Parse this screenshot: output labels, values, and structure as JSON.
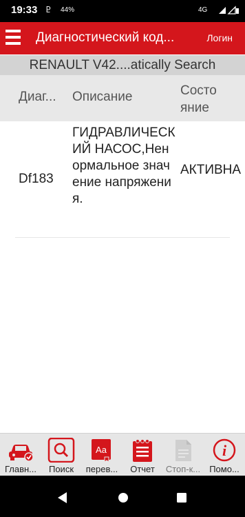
{
  "status": {
    "time": "19:33",
    "usb_glyph": "Ⴒ",
    "battery": "44%",
    "network": "4G"
  },
  "header": {
    "title": "Диагностический код...",
    "login": "Логин"
  },
  "vehicle_bar": "RENAULT V42....atically Search",
  "table": {
    "columns": [
      "Диаг...",
      "Описание",
      "Состо",
      "яние"
    ],
    "rows": [
      {
        "code": "Df183",
        "description": "ГИДРАВЛИЧЕСКИЙ НАСОС,Ненормальное значение напряжения.",
        "state": "АКТИВНА"
      }
    ]
  },
  "toolbar": {
    "items": [
      {
        "label": "Главн...",
        "icon": "car-check-icon"
      },
      {
        "label": "Поиск",
        "icon": "search-icon"
      },
      {
        "label": "перев...",
        "icon": "translate-icon"
      },
      {
        "label": "Отчет",
        "icon": "report-icon"
      },
      {
        "label": "Стоп-к...",
        "icon": "freeze-frame-icon"
      },
      {
        "label": "Помо...",
        "icon": "help-icon"
      }
    ]
  },
  "colors": {
    "accent": "#d4161c",
    "vehicle_bar_bg": "#d3d3d3",
    "table_header_bg": "#e8e8e8",
    "toolbar_bg": "#e6e6e6"
  }
}
